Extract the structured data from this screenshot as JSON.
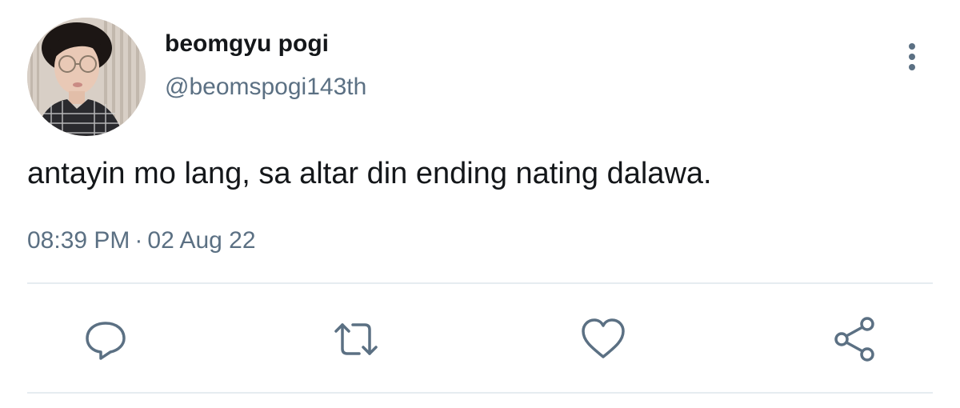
{
  "tweet": {
    "display_name": "beomgyu pogi",
    "handle": "@beomspogi143th",
    "text": "antayin mo lang, sa altar din ending nating dalawa.",
    "time": "08:39 PM",
    "separator": "·",
    "date": "02 Aug 22"
  },
  "icons": {
    "more": "more-vertical-icon",
    "reply": "reply-icon",
    "retweet": "retweet-icon",
    "like": "heart-icon",
    "share": "share-icon"
  },
  "colors": {
    "text": "#14171a",
    "secondary": "#5b7083",
    "divider": "#e6ecf0"
  }
}
